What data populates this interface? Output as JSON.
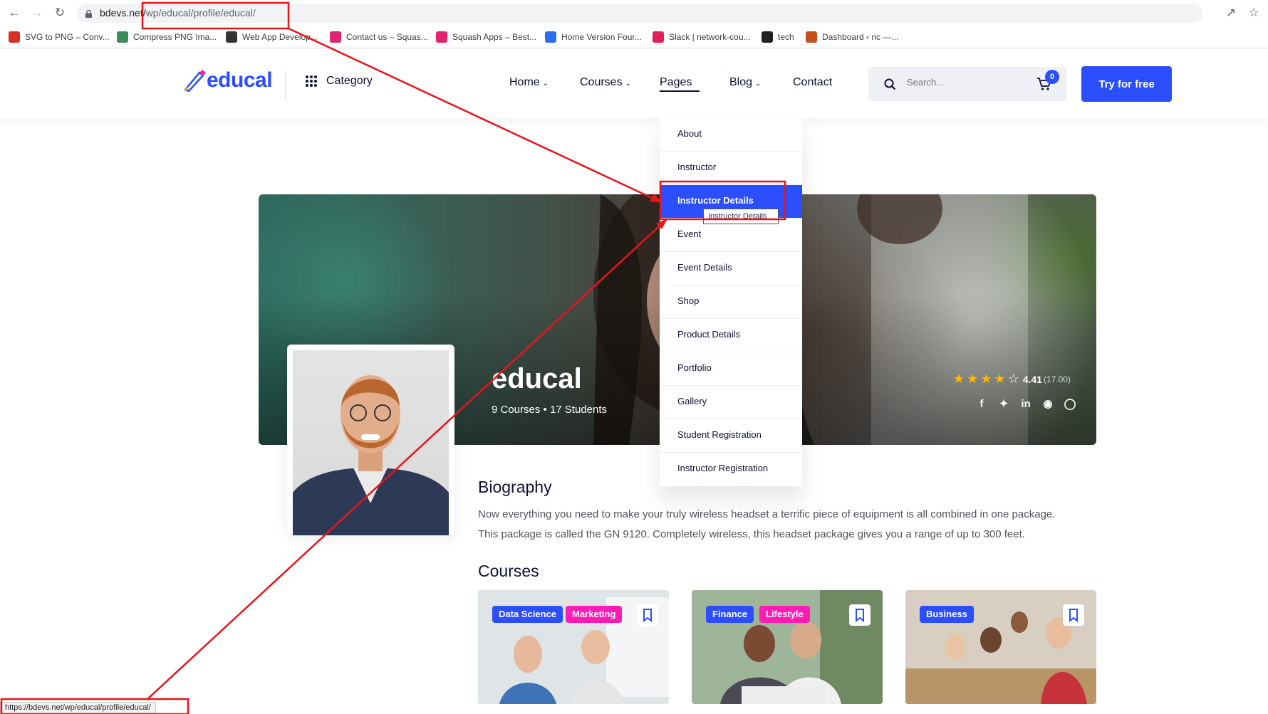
{
  "browser": {
    "url_host": "bdevs.net/",
    "url_path": "wp/educal/profile/educal/",
    "status_url": "https://bdevs.net/wp/educal/profile/educal/",
    "bookmarks": [
      {
        "label": "SVG to PNG – Conv...",
        "color": "#d93025"
      },
      {
        "label": "Compress PNG Ima...",
        "color": "#3c8c5b"
      },
      {
        "label": "Web App Develop...",
        "color": "#333333"
      },
      {
        "label": "Contact us – Squas...",
        "color": "#e0246f"
      },
      {
        "label": "Squash Apps – Best...",
        "color": "#e0246f"
      },
      {
        "label": "Home Version Four...",
        "color": "#2b6cf0"
      },
      {
        "label": "Slack | network-cou...",
        "color": "#e01e5a"
      },
      {
        "label": "tech",
        "color": "#202124"
      },
      {
        "label": "Dashboard ‹ nc —...",
        "color": "#c5521c"
      }
    ]
  },
  "header": {
    "logo": "educal",
    "category": "Category",
    "nav": [
      "Home",
      "Courses",
      "Pages",
      "Blog",
      "Contact"
    ],
    "search_placeholder": "Search...",
    "cart_count": "0",
    "cta": "Try for free",
    "accent": "#2b4eff"
  },
  "dropdown": {
    "items": [
      "About",
      "Instructor",
      "Instructor Details",
      "Event",
      "Event Details",
      "Shop",
      "Product Details",
      "Portfolio",
      "Gallery",
      "Student Registration",
      "Instructor Registration"
    ],
    "active_index": 2,
    "tooltip": "Instructor Details"
  },
  "profile": {
    "name": "educal",
    "meta": "9 Courses • 17 Students",
    "rating_value": "4.41",
    "rating_count": "(17.00)",
    "stars": 4.41
  },
  "biography": {
    "title": "Biography",
    "line1": "Now everything you need to make your truly wireless headset a terrific piece of equipment is all combined in one package.",
    "line2": "This package is called the GN 9120. Completely wireless, this headset package gives you a range of up to 300 feet."
  },
  "courses": {
    "title": "Courses",
    "cards": [
      {
        "tags": [
          {
            "label": "Data Science",
            "color": "#2b4eff"
          },
          {
            "label": "Marketing",
            "color": "#ff1cb5"
          }
        ]
      },
      {
        "tags": [
          {
            "label": "Finance",
            "color": "#2b4eff"
          },
          {
            "label": "Lifestyle",
            "color": "#ff1cb5"
          }
        ]
      },
      {
        "tags": [
          {
            "label": "Business",
            "color": "#2b4eff"
          }
        ]
      }
    ]
  },
  "annotation_color": "#e8141c"
}
